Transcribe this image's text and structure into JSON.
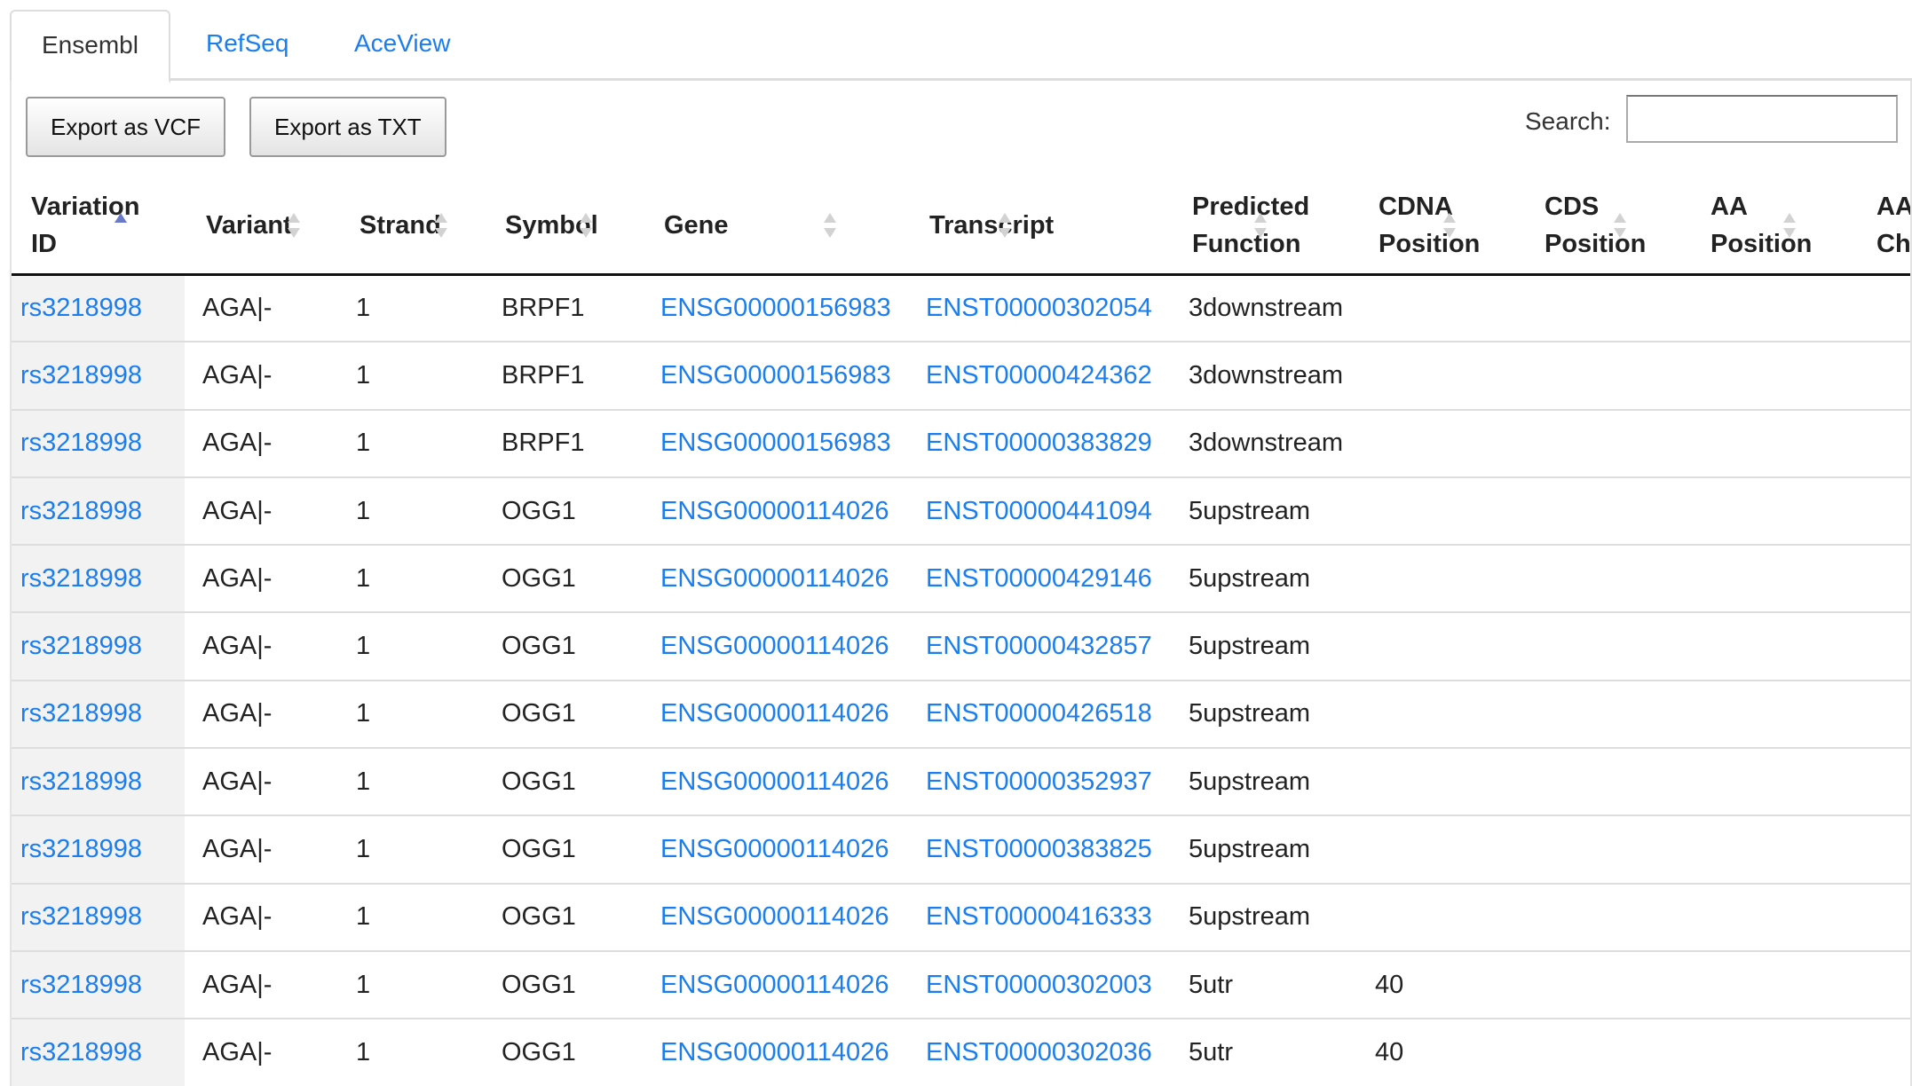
{
  "tabs": [
    "Ensembl",
    "RefSeq",
    "AceView"
  ],
  "toolbar": {
    "export_vcf": "Export as VCF",
    "export_txt": "Export as TXT"
  },
  "search": {
    "label": "Search:",
    "value": ""
  },
  "table": {
    "columns": [
      "Variation ID",
      "Variant",
      "Strand",
      "Symbol",
      "Gene",
      "Transcript",
      "Predicted Function",
      "CDNA Position",
      "CDS Position",
      "AA Position",
      "AA Change"
    ],
    "sorted_column": "Variation ID",
    "sort_direction": "ascending",
    "rows": [
      [
        "rs3218998",
        "AGA|-",
        "1",
        "BRPF1",
        "ENSG00000156983",
        "ENST00000302054",
        "3downstream",
        "",
        "",
        "",
        ""
      ],
      [
        "rs3218998",
        "AGA|-",
        "1",
        "BRPF1",
        "ENSG00000156983",
        "ENST00000424362",
        "3downstream",
        "",
        "",
        "",
        ""
      ],
      [
        "rs3218998",
        "AGA|-",
        "1",
        "BRPF1",
        "ENSG00000156983",
        "ENST00000383829",
        "3downstream",
        "",
        "",
        "",
        ""
      ],
      [
        "rs3218998",
        "AGA|-",
        "1",
        "OGG1",
        "ENSG00000114026",
        "ENST00000441094",
        "5upstream",
        "",
        "",
        "",
        ""
      ],
      [
        "rs3218998",
        "AGA|-",
        "1",
        "OGG1",
        "ENSG00000114026",
        "ENST00000429146",
        "5upstream",
        "",
        "",
        "",
        ""
      ],
      [
        "rs3218998",
        "AGA|-",
        "1",
        "OGG1",
        "ENSG00000114026",
        "ENST00000432857",
        "5upstream",
        "",
        "",
        "",
        ""
      ],
      [
        "rs3218998",
        "AGA|-",
        "1",
        "OGG1",
        "ENSG00000114026",
        "ENST00000426518",
        "5upstream",
        "",
        "",
        "",
        ""
      ],
      [
        "rs3218998",
        "AGA|-",
        "1",
        "OGG1",
        "ENSG00000114026",
        "ENST00000352937",
        "5upstream",
        "",
        "",
        "",
        ""
      ],
      [
        "rs3218998",
        "AGA|-",
        "1",
        "OGG1",
        "ENSG00000114026",
        "ENST00000383825",
        "5upstream",
        "",
        "",
        "",
        ""
      ],
      [
        "rs3218998",
        "AGA|-",
        "1",
        "OGG1",
        "ENSG00000114026",
        "ENST00000416333",
        "5upstream",
        "",
        "",
        "",
        ""
      ],
      [
        "rs3218998",
        "AGA|-",
        "1",
        "OGG1",
        "ENSG00000114026",
        "ENST00000302003",
        "5utr",
        "40",
        "",
        "",
        ""
      ],
      [
        "rs3218998",
        "AGA|-",
        "1",
        "OGG1",
        "ENSG00000114026",
        "ENST00000302036",
        "5utr",
        "40",
        "",
        "",
        ""
      ]
    ]
  },
  "colors": {
    "link": "#1a7ef0",
    "sort_active": "#6a79c8",
    "sorted_column_bg": "#f2f2f2"
  }
}
